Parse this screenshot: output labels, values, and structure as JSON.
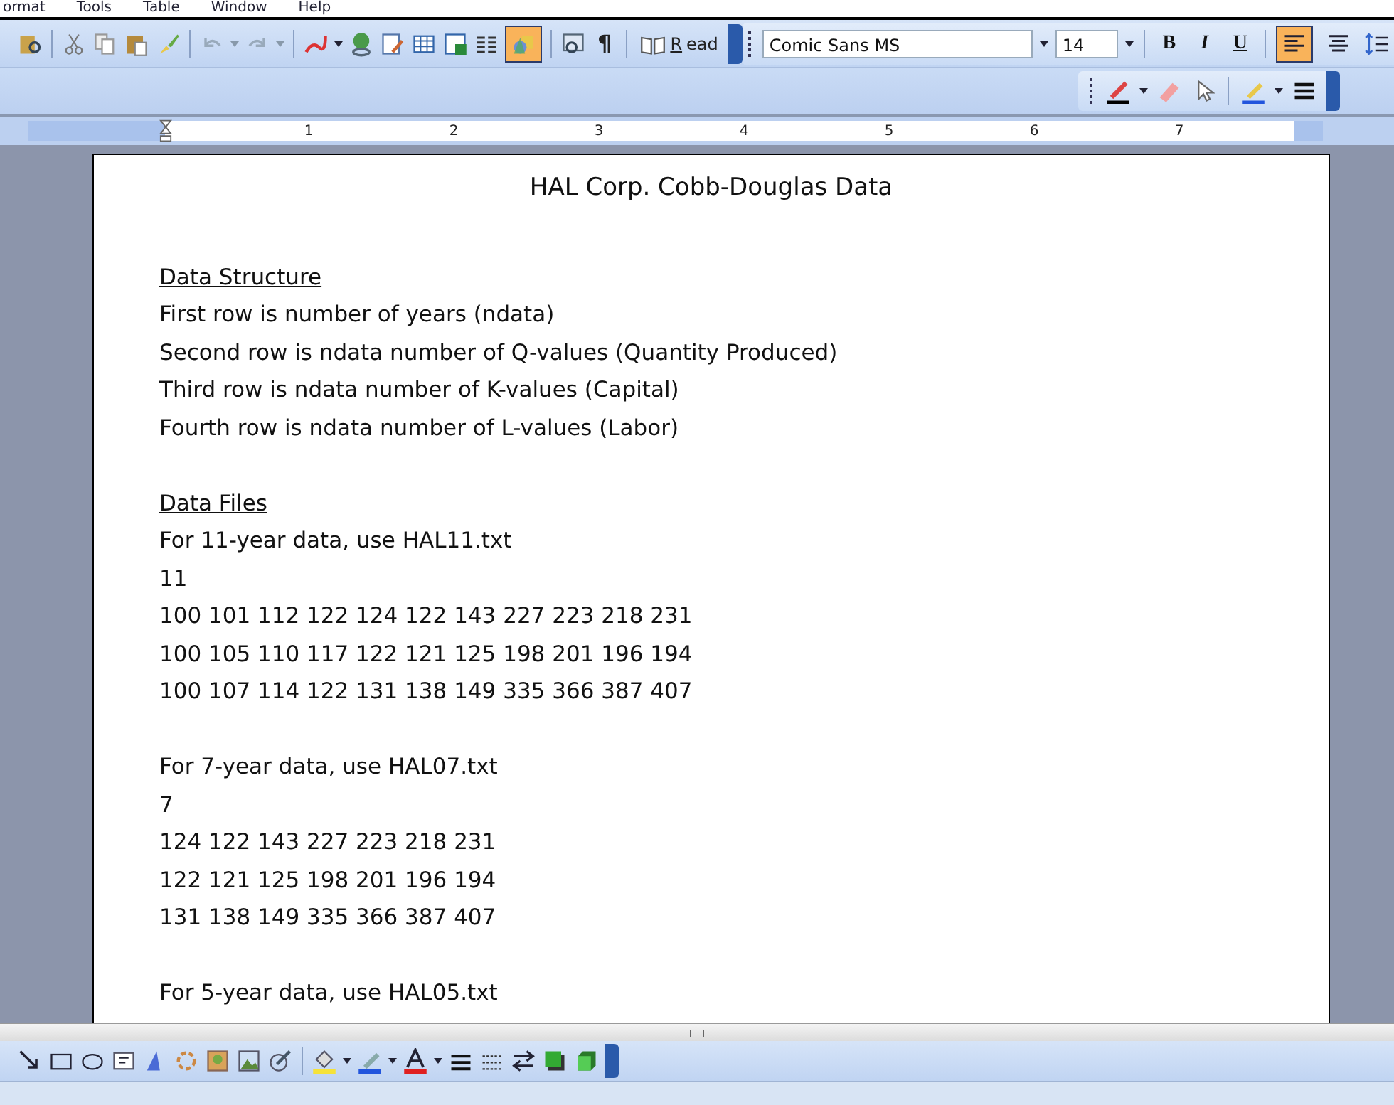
{
  "menu": [
    "ormat",
    "Tools",
    "Table",
    "Window",
    "Help"
  ],
  "standard_toolbar": {
    "drawing_selected": true,
    "show_formatting": "¶",
    "read_label": "Read"
  },
  "formatting_toolbar": {
    "font": "Comic Sans MS",
    "size": "14",
    "bold": "B",
    "italic": "I",
    "underline": "U",
    "align_left_selected": true,
    "align_center_selected": false
  },
  "ruler": {
    "marks": [
      "1",
      "2",
      "3",
      "4",
      "5",
      "6",
      "7"
    ]
  },
  "document": {
    "title": "HAL Corp. Cobb-Douglas Data",
    "lines": [
      {
        "kind": "blank"
      },
      {
        "kind": "heading",
        "text": "Data Structure"
      },
      {
        "kind": "line",
        "text": "First row is number of years (ndata)"
      },
      {
        "kind": "line",
        "text": "Second row is ndata number of Q-values (Quantity Produced)"
      },
      {
        "kind": "line",
        "text": "Third row is ndata number of K-values (Capital)"
      },
      {
        "kind": "line",
        "text": "Fourth row is ndata number of L-values (Labor)"
      },
      {
        "kind": "blank"
      },
      {
        "kind": "heading",
        "text": "Data Files"
      },
      {
        "kind": "line",
        "text": "For 11-year data, use HAL11.txt"
      },
      {
        "kind": "line",
        "text": "11"
      },
      {
        "kind": "line",
        "text": "100 101 112 122 124 122 143 227 223 218 231"
      },
      {
        "kind": "line",
        "text": "100 105 110 117 122 121 125 198 201 196 194"
      },
      {
        "kind": "line",
        "text": "100 107 114 122 131 138 149 335 366 387 407"
      },
      {
        "kind": "blank"
      },
      {
        "kind": "line",
        "text": "For 7-year data, use HAL07.txt"
      },
      {
        "kind": "line",
        "text": "7"
      },
      {
        "kind": "line",
        "text": "124 122 143 227 223 218 231"
      },
      {
        "kind": "line",
        "text": "122 121 125 198 201 196 194"
      },
      {
        "kind": "line",
        "text": "131 138 149 335 366 387 407"
      },
      {
        "kind": "blank"
      },
      {
        "kind": "line",
        "text": "For 5-year data, use HAL05.txt"
      }
    ]
  }
}
